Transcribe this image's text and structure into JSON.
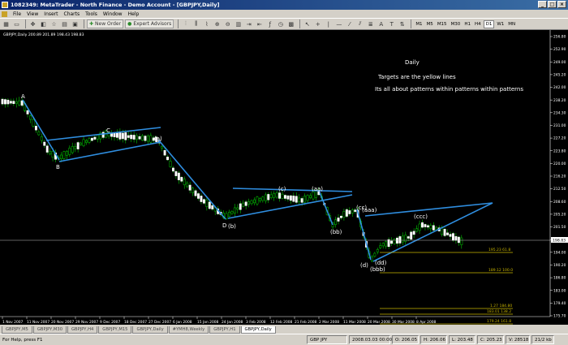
{
  "window": {
    "title": "1082349: MetaTrader - North Finance - Demo Account - [GBPJPY,Daily]",
    "buttons": [
      "_",
      "□",
      "×"
    ]
  },
  "menu": [
    "File",
    "View",
    "Insert",
    "Charts",
    "Tools",
    "Window",
    "Help"
  ],
  "toolbar": {
    "new_order": "New Order",
    "expert_advisors": "Expert Advisors",
    "timeframes": [
      "M1",
      "M5",
      "M15",
      "M30",
      "H1",
      "H4",
      "D1",
      "W1",
      "MN"
    ],
    "active_timeframe": "D1"
  },
  "chart": {
    "header": "GBPJPY,Daily  200.89 201.89 198.43 198.83",
    "notes": [
      "Daily",
      "Targets are the yellow lines",
      "Its all about patterns within patterns within patterns"
    ],
    "wave_labels": [
      "A",
      "B",
      "C",
      "(a)",
      "(c)",
      "(aa)",
      "(bb)",
      "(cc)",
      "(aaa)",
      "(ccc)",
      "D",
      "(b)",
      "(d)",
      "(dd)",
      "(bbb)"
    ],
    "current_price": "198.83",
    "price_ticks": [
      "256.80",
      "252.90",
      "249.00",
      "245.20",
      "242.00",
      "238.20",
      "234.30",
      "231.00",
      "227.20",
      "223.80",
      "220.00",
      "216.20",
      "212.50",
      "208.60",
      "205.20",
      "201.50",
      "197.70",
      "194.00",
      "190.20",
      "186.80",
      "183.00",
      "179.40",
      "175.70"
    ],
    "date_ticks": [
      "1 Nov 2007",
      "11 Nov 2007",
      "20 Nov 2007",
      "29 Nov 2007",
      "9 Dec 2007",
      "18 Dec 2007",
      "27 Dec 2007",
      "6 Jan 2008",
      "15 Jan 2008",
      "24 Jan 2008",
      "3 Feb 2008",
      "12 Feb 2008",
      "21 Feb 2008",
      "2 Mar 2008",
      "11 Mar 2008",
      "20 Mar 2008",
      "30 Mar 2008",
      "8 Apr 2008"
    ],
    "targets": [
      "195.23 61.8",
      "189.12 100.0",
      "1.27 184.80",
      "183.01 138.2",
      "179.24 161.8"
    ],
    "colors": {
      "trend": "#2f8ee0",
      "target": "#c8b400",
      "bull_candle": "#00c800",
      "bear_candle": "#ffffff",
      "bg": "#000000"
    }
  },
  "tabs": [
    "GBPJPY,M5",
    "GBPJPY,M30",
    "GBPJPY,H4",
    "GBPJPY,M15",
    "GBPJPY,Daily",
    "#YMH8,Weekly",
    "GBPJPY,H1",
    "GBPJPY,Daily"
  ],
  "active_tab": 7,
  "status": {
    "help": "For Help, press F1",
    "symbol": "GBP JPY",
    "datetime": "2008.03.03 00:00",
    "open": "O: 206.05",
    "high": "H: 206.06",
    "low": "L: 203.48",
    "close": "C: 205.23",
    "volume": "V: 28518",
    "traffic": "21/2 kb"
  }
}
